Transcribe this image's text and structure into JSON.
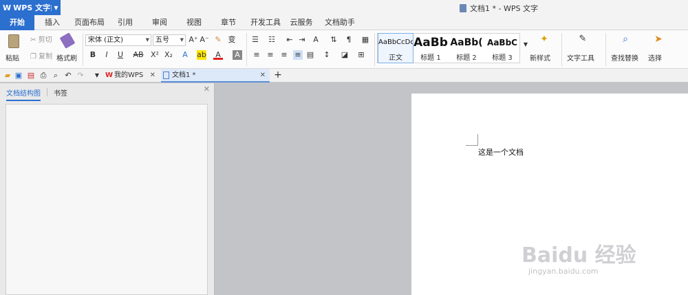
{
  "titlebar": {
    "app_menu": "WPS 文字",
    "app_logo": "W",
    "doc_title": "文档1 * - WPS 文字"
  },
  "menu": {
    "tabs": [
      "开始",
      "插入",
      "页面布局",
      "引用",
      "审阅",
      "视图",
      "章节",
      "开发工具",
      "云服务",
      "文档助手"
    ],
    "active": "开始"
  },
  "ribbon": {
    "paste": "粘贴",
    "cut": "剪切",
    "copy": "复制",
    "format_painter": "格式刷",
    "font_name": "宋体 (正文)",
    "font_size": "五号",
    "styles": [
      {
        "sample": "AaBbCcDd",
        "label": "正文"
      },
      {
        "sample": "AaBb",
        "label": "标题 1"
      },
      {
        "sample": "AaBb(",
        "label": "标题 2"
      },
      {
        "sample": "AaBbC",
        "label": "标题 3"
      }
    ],
    "new_style": "新样式",
    "text_tools": "文字工具",
    "find_replace": "查找替换",
    "select": "选择"
  },
  "doc_tabs": {
    "home": "我的WPS",
    "doc": "文档1 *"
  },
  "panel": {
    "tab_outline": "文档结构图",
    "tab_bookmark": "书签"
  },
  "document": {
    "text": "这是一个文档"
  },
  "watermark": {
    "brand": "Baidu 经验",
    "url": "jingyan.baidu.com"
  }
}
